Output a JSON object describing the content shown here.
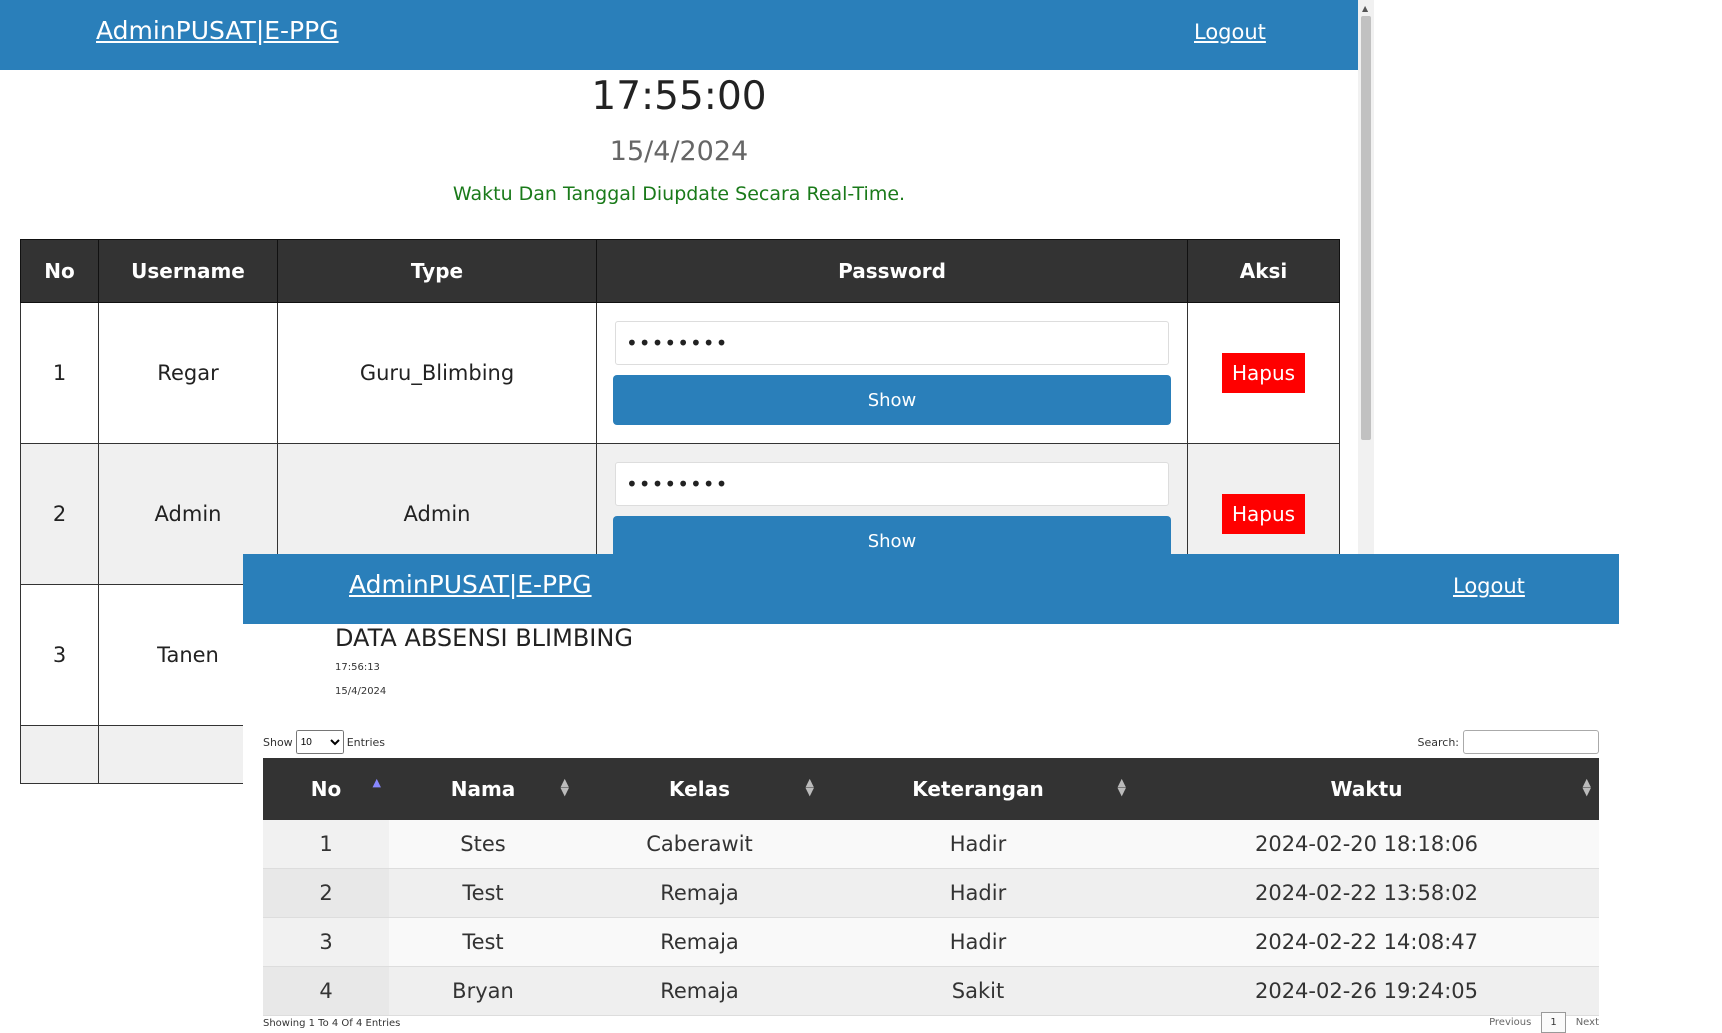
{
  "header": {
    "brand": "AdminPUSAT|E-PPG",
    "logout": "Logout"
  },
  "clock": {
    "time": "17:55:00",
    "date": "15/4/2024",
    "note": "Waktu Dan Tanggal Diupdate Secara Real-Time."
  },
  "user_table": {
    "headers": [
      "No",
      "Username",
      "Type",
      "Password",
      "Aksi"
    ],
    "rows": [
      {
        "no": "1",
        "username": "Regar",
        "type": "Guru_Blimbing",
        "password": "••••••••",
        "show": "Show",
        "action": "Hapus"
      },
      {
        "no": "2",
        "username": "Admin",
        "type": "Admin",
        "password": "••••••••",
        "show": "Show",
        "action": "Hapus"
      },
      {
        "no": "3",
        "username": "Tanen"
      }
    ]
  },
  "absensi": {
    "title": "DATA ABSENSI BLIMBING",
    "time": "17:56:13",
    "date": "15/4/2024",
    "show_label": "Show",
    "entries_label": "Entries",
    "page_length": "10",
    "search_label": "Search:",
    "headers": [
      "No",
      "Nama",
      "Kelas",
      "Keterangan",
      "Waktu"
    ],
    "rows": [
      [
        "1",
        "Stes",
        "Caberawit",
        "Hadir",
        "2024-02-20 18:18:06"
      ],
      [
        "2",
        "Test",
        "Remaja",
        "Hadir",
        "2024-02-22 13:58:02"
      ],
      [
        "3",
        "Test",
        "Remaja",
        "Hadir",
        "2024-02-22 14:08:47"
      ],
      [
        "4",
        "Bryan",
        "Remaja",
        "Sakit",
        "2024-02-26 19:24:05"
      ]
    ],
    "info": "Showing 1 To 4 Of 4 Entries",
    "pager": {
      "previous": "Previous",
      "current": "1",
      "next": "Next"
    }
  },
  "colors": {
    "navbar": "#2a7fba",
    "table_header": "#333333",
    "delete": "#ff0000",
    "note": "#1a7a1a"
  }
}
